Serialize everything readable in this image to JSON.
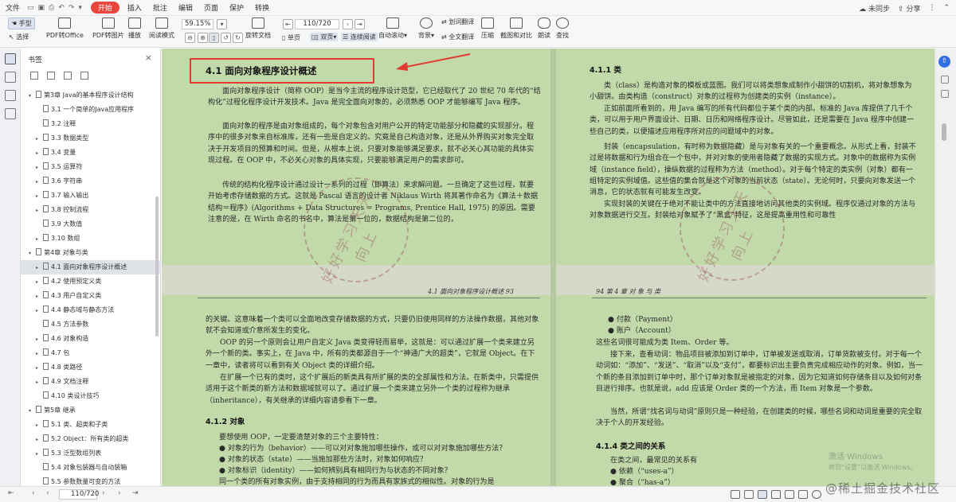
{
  "menubar": {
    "file": "文件",
    "tabs": [
      "开始",
      "插入",
      "批注",
      "编辑",
      "页面",
      "保护",
      "转换"
    ],
    "active_tab": "开始",
    "unsynced": "未同步",
    "share": "分享"
  },
  "toolbar": {
    "hand": "手型",
    "select": "选择",
    "pdf_to_office": "PDF转Office",
    "pdf_to_image": "PDF转图片",
    "play": "播放",
    "read_mode": "阅读模式",
    "zoom": "59.15%",
    "page_input": "110/720",
    "rotate": "旋转文档",
    "single_page": "单页",
    "double_page": "双页",
    "continuous": "连续阅读",
    "auto_scroll": "自动滚动",
    "background": "背景",
    "word_translate": "划词翻译",
    "full_translate": "全文翻译",
    "compress": "压缩",
    "screenshot_compare": "截图和对比",
    "read_aloud": "朗读",
    "find": "查找"
  },
  "sidebar": {
    "title": "书签",
    "items": [
      {
        "label": "第3章 Java的基本程序设计结构",
        "level": 0,
        "expanded": true
      },
      {
        "label": "3.1 一个简单的Java应用程序",
        "level": 1,
        "expandable": false
      },
      {
        "label": "3.2 注释",
        "level": 1,
        "expandable": false
      },
      {
        "label": "3.3 数据类型",
        "level": 1,
        "expandable": true
      },
      {
        "label": "3.4 变量",
        "level": 1,
        "expandable": true
      },
      {
        "label": "3.5 运算符",
        "level": 1,
        "expandable": true
      },
      {
        "label": "3.6 字符串",
        "level": 1,
        "expandable": true
      },
      {
        "label": "3.7 输入输出",
        "level": 1,
        "expandable": true
      },
      {
        "label": "3.8 控制流程",
        "level": 1,
        "expandable": true
      },
      {
        "label": "3.9 大数值",
        "level": 1,
        "expandable": false
      },
      {
        "label": "3.10 数组",
        "level": 1,
        "expandable": true
      },
      {
        "label": "第4章 对象与类",
        "level": 0,
        "expanded": true
      },
      {
        "label": "4.1 面向对象程序设计概述",
        "level": 1,
        "expandable": true,
        "selected": true
      },
      {
        "label": "4.2 使用预定义类",
        "level": 1,
        "expandable": true
      },
      {
        "label": "4.3 用户自定义类",
        "level": 1,
        "expandable": true
      },
      {
        "label": "4.4 静态域与静态方法",
        "level": 1,
        "expandable": true
      },
      {
        "label": "4.5 方法参数",
        "level": 1,
        "expandable": false
      },
      {
        "label": "4.6 对象构造",
        "level": 1,
        "expandable": true
      },
      {
        "label": "4.7 包",
        "level": 1,
        "expandable": true
      },
      {
        "label": "4.8 类路径",
        "level": 1,
        "expandable": true
      },
      {
        "label": "4.9 文档注释",
        "level": 1,
        "expandable": true
      },
      {
        "label": "4.10 类设计技巧",
        "level": 1,
        "expandable": false
      },
      {
        "label": "第5章 继承",
        "level": 0,
        "expanded": true
      },
      {
        "label": "5.1 类、超类和子类",
        "level": 1,
        "expandable": true
      },
      {
        "label": "5.2 Object：所有类的超类",
        "level": 1,
        "expandable": true
      },
      {
        "label": "5.3 泛型数组列表",
        "level": 1,
        "expandable": true
      },
      {
        "label": "5.4 对象包装器与自动装箱",
        "level": 1,
        "expandable": false
      },
      {
        "label": "5.5 参数数量可变的方法",
        "level": 1,
        "expandable": false
      }
    ]
  },
  "doc": {
    "p93": {
      "heading": "4.1  面向对象程序设计概述",
      "paras": [
        "面向对象程序设计（简称 OOP）是当今主流的程序设计范型，它已经取代了 20 世纪 70 年代的“结构化”过程化程序设计开发技术。Java 是完全面向对象的，必须熟悉 OOP 才能够编写 Java 程序。",
        "面向对象的程序是由对象组成的，每个对象包含对用户公开的特定功能部分和隐藏的实现部分。程序中的很多对象来自标准库，还有一些是自定义的。究竟是自己构造对象，还是从外界购买对象完全取决于开发项目的预算和时间。但是，从根本上说，只要对象能够满足要求，就不必关心其功能的具体实现过程。在 OOP 中，不必关心对象的具体实现，只要能够满足用户的需求即可。",
        "传统的结构化程序设计通过设计一系列的过程（即算法）来求解问题。一旦确定了这些过程，就要开始考虑存储数据的方式。这就是 Pascal 语言的设计者 Niklaus Wirth 将其著作命名为《算法＋数据结构＝程序》(Algorithms + Data Structures = Programs, Prentice Hall, 1975) 的原因。需要注意的是，在 Wirth 命名的书名中，算法是第一位的，数据结构是第二位的，"
      ],
      "running_header": "4.1  面向对象程序设计概述    93"
    },
    "p94_top": {
      "subheading": "4.1.1  类",
      "paras": [
        "类（class）是构造对象的模板或蓝图。我们可以将类想象成制作小甜饼的切割机，将对象想象为小甜饼。由类构造（construct）对象的过程称为创建类的实例（instance）。",
        "正如前面所看到的，用 Java 编写的所有代码都位于某个类的内部。标准的 Java 库提供了几千个类，可以用于用户界面设计、日期、日历和网络程序设计。尽管如此，还是需要在 Java 程序中创建一些自己的类，以便描述应用程序所对应的问题域中的对象。",
        "封装（encapsulation，有时称为数据隐藏）是与对象有关的一个重要概念。从形式上看，封装不过是将数据和行为组合在一个包中，并对对象的使用者隐藏了数据的实现方式。对象中的数据称为实例域（instance field），操纵数据的过程称为方法（method）。对于每个特定的类实例（对象）都有一组特定的实例域值。这些值的集合就是这个对象的当前状态（state）。无论何时，只要向对象发送一个消息，它的状态就有可能发生改变。",
        "实现封装的关键在于绝对不能让类中的方法直接地访问其他类的实例域。程序仅通过对象的方法与对象数据进行交互。封装给对象赋予了“黑盒”特征，这是提高重用性和可靠性"
      ]
    },
    "p94": {
      "paras": [
        "的关键。这意味着一个类可以全面地改变存储数据的方式，只要仍旧使用同样的方法操作数据，其他对象就不会知道或介意所发生的变化。",
        "OOP 的另一个原则会让用户自定义 Java 类变得轻而易举，这就是：可以通过扩展一个类来建立另外一个新的类。事实上，在 Java 中，所有的类都源自于一个“神通广大的超类”，它就是 Object。在下一章中，读者将可以看到有关 Object 类的详细介绍。",
        "在扩展一个已有的类时，这个扩展后的新类具有所扩展的类的全部属性和方法。在新类中，只需提供适用于这个新类的新方法和数据域就可以了。通过扩展一个类来建立另外一个类的过程称为继承（inheritance），有关继承的详细内容请参看下一章。"
      ],
      "subheading": "4.1.2  对象",
      "intro": "要想使用 OOP，一定要清楚对象的三个主要特性：",
      "bullets": [
        "● 对象的行为（behavior）——可以对对象施加哪些操作，或可以对对象施加哪些方法？",
        "● 对象的状态（state）——当施加那些方法时，对象如何响应？",
        "● 对象标识（identity）——如何辨别具有相同行为与状态的不同对象？"
      ],
      "tail": "同一个类的所有对象实例，由于支持相同的行为而具有家族式的相似性。对象的行为是"
    },
    "p95": {
      "running_header": "94  第 4 章  对 象 与 类",
      "bullets": [
        "● 付款（Payment）",
        "● 账户（Account）"
      ],
      "paras": [
        "这些名词很可能成为类 Item、Order 等。",
        "接下来，查看动词：物品项目被添加到订单中，订单被发送或取消，订单货款被支付。对于每一个动词如：“添加”、“发送”、“取消”以及“支付”，都要标识出主要负责完成相应动作的对象。例如，当一个新的条目添加到订单中时，那个订单对象就是被指定的对象，因为它知道如何存储条目以及如何对条目进行排序。也就是说，add 应该是 Order 类的一个方法，而 Item 对象是一个参数。",
        "当然，所谓“找名词与动词”原则只是一种经验，在创建类的时候，哪些名词和动词是重要的完全取决于个人的开发经验。"
      ],
      "subheading": "4.1.4  类之间的关系",
      "intro": "在类之间，最常见的关系有",
      "bullets2": [
        "● 依赖（“uses-a”）",
        "● 聚合（“has-a”）"
      ]
    }
  },
  "stamp_text": "好好学习天天向上",
  "annotation_color": "#e13b33",
  "accent_color": "#e8453c",
  "page_bg_color": "#c2d9aa",
  "statusbar": {
    "page": "110/720"
  },
  "watermark": {
    "line1": "激活 Windows",
    "line2": "转到“设置”以激活 Windows。"
  },
  "site_watermark": "@稀土掘金技术社区"
}
